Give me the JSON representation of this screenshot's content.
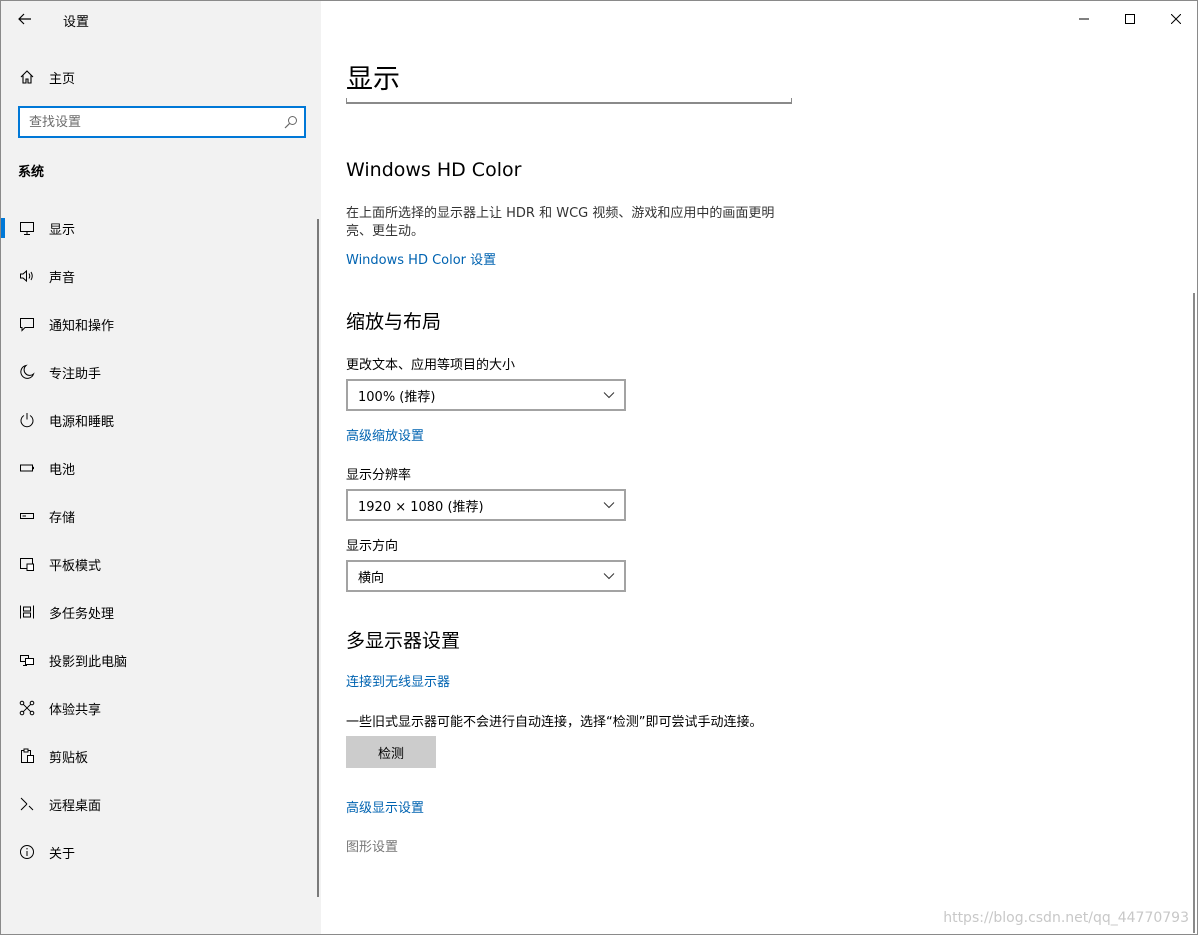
{
  "app": {
    "title": "设置"
  },
  "sidebar": {
    "home_label": "主页",
    "search_placeholder": "查找设置",
    "section_title": "系统",
    "items": [
      {
        "label": "显示",
        "icon": "monitor-icon",
        "active": true
      },
      {
        "label": "声音",
        "icon": "speaker-icon"
      },
      {
        "label": "通知和操作",
        "icon": "notification-icon"
      },
      {
        "label": "专注助手",
        "icon": "moon-icon"
      },
      {
        "label": "电源和睡眠",
        "icon": "power-icon"
      },
      {
        "label": "电池",
        "icon": "battery-icon"
      },
      {
        "label": "存储",
        "icon": "storage-icon"
      },
      {
        "label": "平板模式",
        "icon": "tablet-mode-icon"
      },
      {
        "label": "多任务处理",
        "icon": "multitasking-icon"
      },
      {
        "label": "投影到此电脑",
        "icon": "projection-icon"
      },
      {
        "label": "体验共享",
        "icon": "share-experience-icon"
      },
      {
        "label": "剪贴板",
        "icon": "clipboard-icon"
      },
      {
        "label": "远程桌面",
        "icon": "remote-desktop-icon"
      },
      {
        "label": "关于",
        "icon": "info-icon"
      }
    ]
  },
  "main": {
    "page_title": "显示",
    "hdr": {
      "heading": "Windows HD Color",
      "description": "在上面所选择的显示器上让 HDR 和 WCG 视频、游戏和应用中的画面更明亮、更生动。",
      "link": "Windows HD Color 设置"
    },
    "scale": {
      "heading": "缩放与布局",
      "text_size_label": "更改文本、应用等项目的大小",
      "text_size_value": "100% (推荐)",
      "advanced_scale_link": "高级缩放设置",
      "resolution_label": "显示分辨率",
      "resolution_value": "1920 × 1080 (推荐)",
      "orientation_label": "显示方向",
      "orientation_value": "横向"
    },
    "multi": {
      "heading": "多显示器设置",
      "wireless_link": "连接到无线显示器",
      "detect_note": "一些旧式显示器可能不会进行自动连接，选择“检测”即可尝试手动连接。",
      "detect_button": "检测",
      "advanced_display_link": "高级显示设置",
      "graphics_settings": "图形设置"
    }
  },
  "watermark": "https://blog.csdn.net/qq_44770793",
  "colors": {
    "accent": "#0078d7",
    "link": "#0063b1",
    "sidebar_bg": "#f2f2f2"
  }
}
